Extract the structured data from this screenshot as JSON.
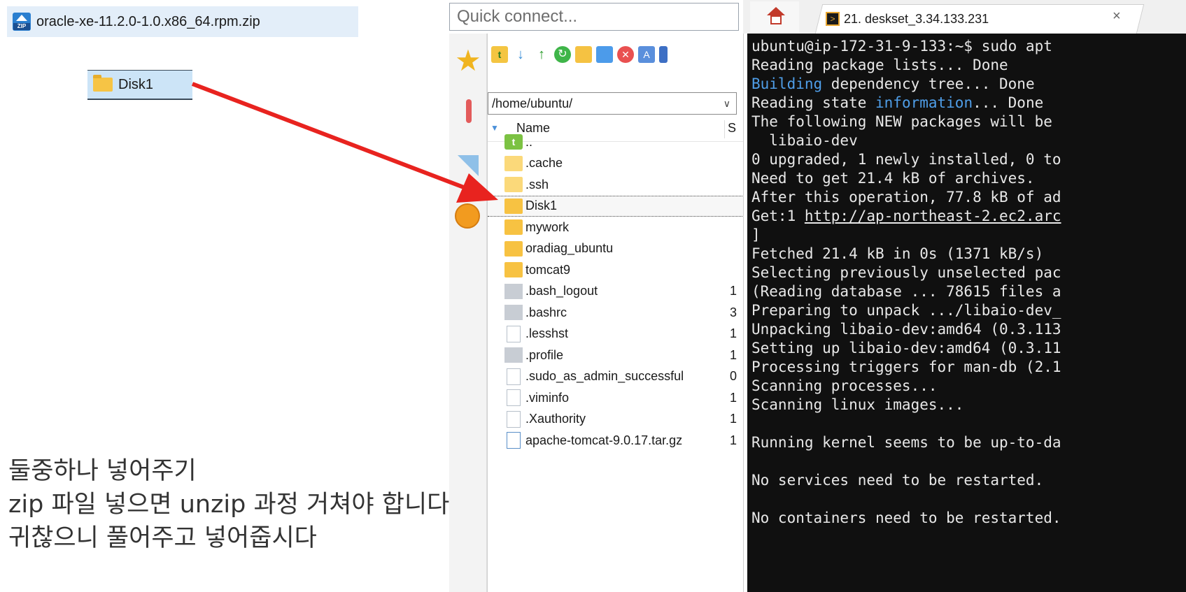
{
  "desktop": {
    "zip_file_label": "oracle-xe-11.2.0-1.0.x86_64.rpm.zip",
    "zip_icon_tag": "ZIP",
    "disk_folder_label": "Disk1"
  },
  "caption": {
    "line1": "둘중하나 넣어주기",
    "line2": "zip 파일 넣으면 unzip 과정 거쳐야 합니다.",
    "line3": "귀찮으니 풀어주고 넣어줍시다"
  },
  "winscp": {
    "quick_connect_placeholder": "Quick connect...",
    "path": "/home/ubuntu/",
    "name_column": "Name",
    "size_column": "S",
    "files": [
      {
        "name": "..",
        "type": "parent",
        "size": ""
      },
      {
        "name": ".cache",
        "type": "folder-light",
        "size": ""
      },
      {
        "name": ".ssh",
        "type": "folder-light",
        "size": ""
      },
      {
        "name": "Disk1",
        "type": "folder",
        "size": "",
        "selected": true
      },
      {
        "name": "mywork",
        "type": "folder",
        "size": ""
      },
      {
        "name": "oradiag_ubuntu",
        "type": "folder",
        "size": ""
      },
      {
        "name": "tomcat9",
        "type": "folder",
        "size": ""
      },
      {
        "name": ".bash_logout",
        "type": "file-grey",
        "size": "1"
      },
      {
        "name": ".bashrc",
        "type": "file-grey",
        "size": "3"
      },
      {
        "name": ".lesshst",
        "type": "file-white",
        "size": "1"
      },
      {
        "name": ".profile",
        "type": "file-grey",
        "size": "1"
      },
      {
        "name": ".sudo_as_admin_successful",
        "type": "file-white",
        "size": "0"
      },
      {
        "name": ".viminfo",
        "type": "file-white",
        "size": "1"
      },
      {
        "name": ".Xauthority",
        "type": "file-white",
        "size": "1"
      },
      {
        "name": "apache-tomcat-9.0.17.tar.gz",
        "type": "archive",
        "size": "1"
      }
    ]
  },
  "terminal": {
    "tab_label": "21. deskset_3.34.133.231",
    "tab_close": "×",
    "lines": [
      {
        "text": "ubuntu@ip-172-31-9-133:~$ sudo apt"
      },
      {
        "text": "Reading package lists... Done"
      },
      {
        "pre": "",
        "hl": "Building",
        "post": " dependency tree... Done"
      },
      {
        "pre": "Reading state ",
        "hl": "information",
        "post": "... Done"
      },
      {
        "text": "The following NEW packages will be"
      },
      {
        "text": "  libaio-dev"
      },
      {
        "text": "0 upgraded, 1 newly installed, 0 to"
      },
      {
        "text": "Need to get 21.4 kB of archives."
      },
      {
        "text": "After this operation, 77.8 kB of ad"
      },
      {
        "pre": "Get:1 ",
        "link": "http://ap-northeast-2.ec2.arc"
      },
      {
        "text": "]"
      },
      {
        "text": "Fetched 21.4 kB in 0s (1371 kB/s)"
      },
      {
        "text": "Selecting previously unselected pac"
      },
      {
        "text": "(Reading database ... 78615 files a"
      },
      {
        "text": "Preparing to unpack .../libaio-dev_"
      },
      {
        "text": "Unpacking libaio-dev:amd64 (0.3.113"
      },
      {
        "text": "Setting up libaio-dev:amd64 (0.3.11"
      },
      {
        "text": "Processing triggers for man-db (2.1"
      },
      {
        "text": "Scanning processes..."
      },
      {
        "text": "Scanning linux images..."
      },
      {
        "text": ""
      },
      {
        "text": "Running kernel seems to be up-to-da"
      },
      {
        "text": ""
      },
      {
        "text": "No services need to be restarted."
      },
      {
        "text": ""
      },
      {
        "text": "No containers need to be restarted."
      }
    ]
  },
  "colors": {
    "arrow": "#e8231f",
    "terminal_bg": "#101010",
    "terminal_highlight": "#4f9ee8",
    "selection": "#cce4f7"
  }
}
